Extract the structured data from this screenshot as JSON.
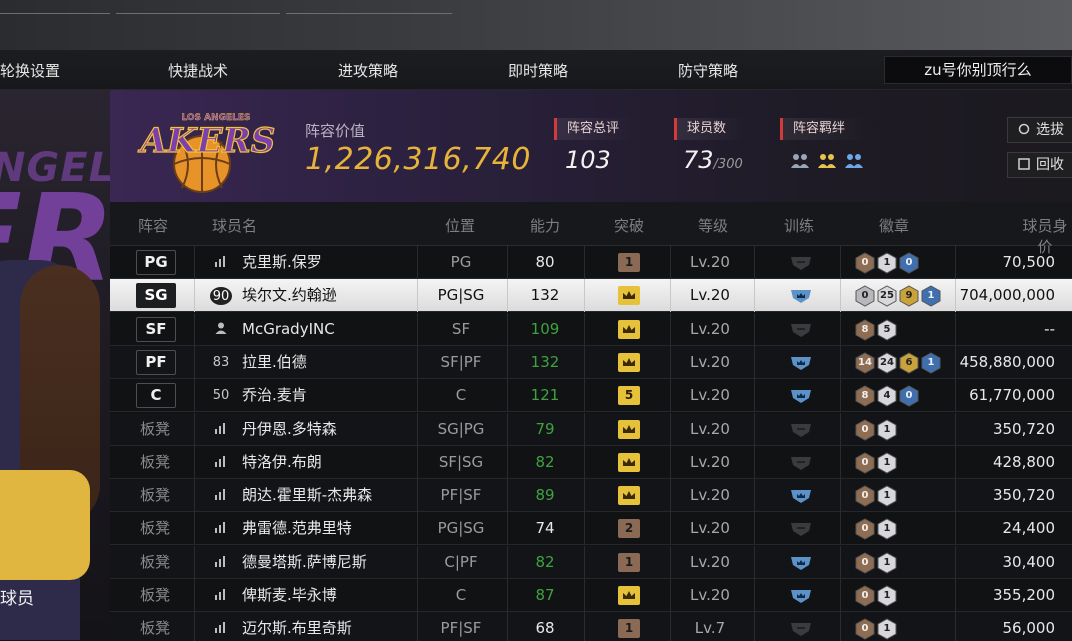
{
  "menu": {
    "items": [
      "轮换设置",
      "快捷战术",
      "进攻策略",
      "即时策略",
      "防守策略"
    ],
    "team_name": "zu号你别顶行么"
  },
  "left_panel": {
    "caption": "球员"
  },
  "lineup": {
    "value_label": "阵容价值",
    "value": "1,226,316,740",
    "rating_label": "阵容总评",
    "rating": "103",
    "players_label": "球员数",
    "players_count": "73",
    "players_max": "/300",
    "bond_label": "阵容羁绊",
    "buttons": {
      "select": "选拔",
      "recycle": "回收"
    }
  },
  "table": {
    "columns": [
      "阵容",
      "球员名",
      "位置",
      "能力",
      "突破",
      "等级",
      "训练",
      "徽章",
      "球员身价"
    ],
    "rows": [
      {
        "slot": "PG",
        "starter": true,
        "info": "",
        "name": "克里斯.保罗",
        "pos": "PG",
        "ability": "80",
        "ability_green": false,
        "break": "1",
        "break_type": "num-brown",
        "level": "Lv.20",
        "train": false,
        "medals": [
          "0",
          "1",
          "0"
        ],
        "medal_types": [
          "bronze",
          "silver",
          "blue"
        ],
        "worth": "70,500"
      },
      {
        "slot": "SG",
        "starter": true,
        "selected": true,
        "info": "90",
        "name": "埃尔文.约翰逊",
        "pos": "PG|SG",
        "ability": "132",
        "ability_green": false,
        "break": "",
        "break_type": "crown",
        "level": "Lv.20",
        "train": true,
        "medals": [
          "0",
          "25",
          "9",
          "1"
        ],
        "medal_types": [
          "plain",
          "silver",
          "gold",
          "blue"
        ],
        "worth": "704,000,000"
      },
      {
        "slot": "SF",
        "starter": true,
        "info": "",
        "name": "McGradyINC",
        "pos": "SF",
        "ability": "109",
        "ability_green": true,
        "break": "",
        "break_type": "crown",
        "level": "Lv.20",
        "train": false,
        "medals": [
          "8",
          "5"
        ],
        "medal_types": [
          "bronze",
          "silver"
        ],
        "worth": "--"
      },
      {
        "slot": "PF",
        "starter": true,
        "info": "83",
        "name": "拉里.伯德",
        "pos": "SF|PF",
        "ability": "132",
        "ability_green": true,
        "break": "",
        "break_type": "crown",
        "level": "Lv.20",
        "train": true,
        "medals": [
          "14",
          "24",
          "6",
          "1"
        ],
        "medal_types": [
          "bronze",
          "silver",
          "gold",
          "blue"
        ],
        "worth": "458,880,000"
      },
      {
        "slot": "C",
        "starter": true,
        "info": "50",
        "name": "乔治.麦肯",
        "pos": "C",
        "ability": "121",
        "ability_green": true,
        "break": "5",
        "break_type": "num-gold",
        "level": "Lv.20",
        "train": true,
        "medals": [
          "8",
          "4",
          "0"
        ],
        "medal_types": [
          "bronze",
          "silver",
          "blue"
        ],
        "worth": "61,770,000"
      },
      {
        "slot": "板凳",
        "starter": false,
        "info": "",
        "name": "丹伊恩.多特森",
        "pos": "SG|PG",
        "ability": "79",
        "ability_green": true,
        "break": "",
        "break_type": "crown",
        "level": "Lv.20",
        "train": false,
        "medals": [
          "0",
          "1"
        ],
        "medal_types": [
          "bronze",
          "silver"
        ],
        "worth": "350,720"
      },
      {
        "slot": "板凳",
        "starter": false,
        "info": "",
        "name": "特洛伊.布朗",
        "pos": "SF|SG",
        "ability": "82",
        "ability_green": true,
        "break": "",
        "break_type": "crown",
        "level": "Lv.20",
        "train": false,
        "medals": [
          "0",
          "1"
        ],
        "medal_types": [
          "bronze",
          "silver"
        ],
        "worth": "428,800"
      },
      {
        "slot": "板凳",
        "starter": false,
        "info": "",
        "name": "朗达.霍里斯-杰弗森",
        "pos": "PF|SF",
        "ability": "89",
        "ability_green": true,
        "break": "",
        "break_type": "crown",
        "level": "Lv.20",
        "train": true,
        "medals": [
          "0",
          "1"
        ],
        "medal_types": [
          "bronze",
          "silver"
        ],
        "worth": "350,720"
      },
      {
        "slot": "板凳",
        "starter": false,
        "info": "",
        "name": "弗雷德.范弗里特",
        "pos": "PG|SG",
        "ability": "74",
        "ability_green": false,
        "break": "2",
        "break_type": "num-brown",
        "level": "Lv.20",
        "train": false,
        "medals": [
          "0",
          "1"
        ],
        "medal_types": [
          "bronze",
          "silver"
        ],
        "worth": "24,400"
      },
      {
        "slot": "板凳",
        "starter": false,
        "info": "",
        "name": "德曼塔斯.萨博尼斯",
        "pos": "C|PF",
        "ability": "82",
        "ability_green": true,
        "break": "1",
        "break_type": "num-brown",
        "level": "Lv.20",
        "train": true,
        "medals": [
          "0",
          "1"
        ],
        "medal_types": [
          "bronze",
          "silver"
        ],
        "worth": "30,400"
      },
      {
        "slot": "板凳",
        "starter": false,
        "info": "",
        "name": "俾斯麦.毕永博",
        "pos": "C",
        "ability": "87",
        "ability_green": true,
        "break": "",
        "break_type": "crown",
        "level": "Lv.20",
        "train": true,
        "medals": [
          "0",
          "1"
        ],
        "medal_types": [
          "bronze",
          "silver"
        ],
        "worth": "355,200"
      },
      {
        "slot": "板凳",
        "starter": false,
        "info": "",
        "name": "迈尔斯.布里奇斯",
        "pos": "PF|SF",
        "ability": "68",
        "ability_green": false,
        "break": "1",
        "break_type": "num-brown",
        "level": "Lv.7",
        "train": false,
        "medals": [
          "0",
          "1"
        ],
        "medal_types": [
          "bronze",
          "silver"
        ],
        "worth": "56,000"
      }
    ]
  },
  "colors": {
    "accent_gold": "#e8b33a",
    "ability_green": "#3ea33e",
    "label_red": "#d33b3b"
  }
}
